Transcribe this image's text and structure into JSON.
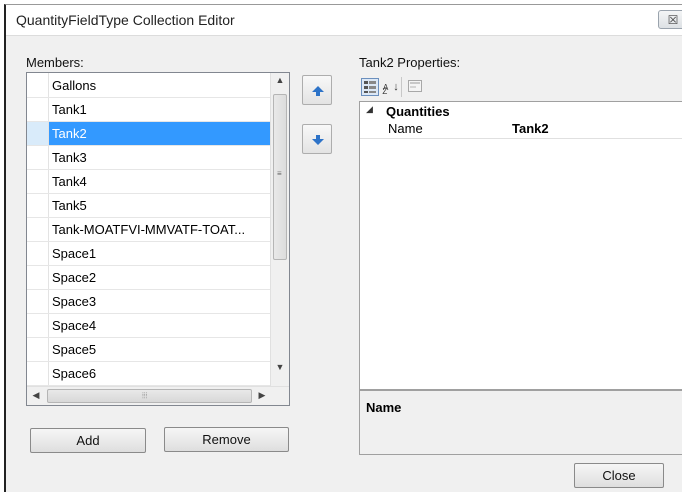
{
  "window": {
    "title": "QuantityFieldType Collection Editor",
    "close_glyph": "☒"
  },
  "members": {
    "label": "Members:",
    "items": [
      "Gallons",
      "Tank1",
      "Tank2",
      "Tank3",
      "Tank4",
      "Tank5",
      "Tank-MOATFVI-MMVATF-TOAT...",
      "Space1",
      "Space2",
      "Space3",
      "Space4",
      "Space5",
      "Space6"
    ],
    "selected_index": 2,
    "add_label": "Add",
    "remove_label": "Remove"
  },
  "properties": {
    "label": "Tank2 Properties:",
    "category": "Quantities",
    "rows": [
      {
        "name": "Name",
        "value": "Tank2"
      }
    ],
    "description_title": "Name"
  },
  "footer": {
    "close_label": "Close"
  },
  "colors": {
    "selection": "#3399ff",
    "move_arrow": "#2d73c8"
  },
  "icons": [
    "categorized-icon",
    "alphabetical-icon",
    "property-pages-icon",
    "move-up-icon",
    "move-down-icon"
  ]
}
